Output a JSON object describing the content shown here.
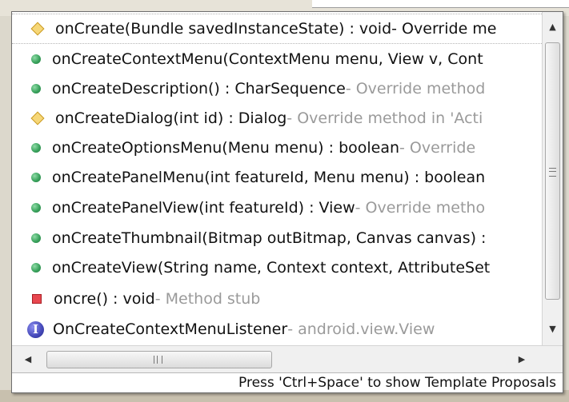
{
  "proposals": [
    {
      "signature": "onCreate(Bundle savedInstanceState) : void",
      "detail": " - Override me",
      "icon": "yellow-diamond-icon"
    },
    {
      "signature": "onCreateContextMenu(ContextMenu menu, View v, Cont",
      "detail": "",
      "icon": "green-dot-icon"
    },
    {
      "signature": "onCreateDescription() : CharSequence",
      "detail": " - Override method",
      "icon": "green-dot-icon"
    },
    {
      "signature": "onCreateDialog(int id) : Dialog",
      "detail": " - Override method in 'Acti",
      "icon": "yellow-diamond-icon"
    },
    {
      "signature": "onCreateOptionsMenu(Menu menu) : boolean",
      "detail": " - Override",
      "icon": "green-dot-icon"
    },
    {
      "signature": "onCreatePanelMenu(int featureId, Menu menu) : boolean",
      "detail": "",
      "icon": "green-dot-icon"
    },
    {
      "signature": "onCreatePanelView(int featureId) : View",
      "detail": " - Override metho",
      "icon": "green-dot-icon"
    },
    {
      "signature": "onCreateThumbnail(Bitmap outBitmap, Canvas canvas) :",
      "detail": "",
      "icon": "green-dot-icon"
    },
    {
      "signature": "onCreateView(String name, Context context, AttributeSet",
      "detail": "",
      "icon": "green-dot-icon"
    },
    {
      "signature": "oncre() : void",
      "detail": " - Method stub",
      "icon": "red-square-icon"
    },
    {
      "signature": "OnCreateContextMenuListener",
      "detail": " - android.view.View",
      "icon": "interface-icon",
      "icon_glyph": "I"
    }
  ],
  "scrollbar": {
    "up_arrow": "▲",
    "down_arrow": "▼",
    "left_arrow": "◀",
    "right_arrow": "▶"
  },
  "status": {
    "hint": "Press 'Ctrl+Space' to show Template Proposals"
  },
  "colors": {
    "detail_text": "#9a9a9a",
    "method_green": "#3aa35d",
    "override_yellow": "#f6d778",
    "stub_red": "#e8474f",
    "interface_blue": "#4448b8"
  }
}
